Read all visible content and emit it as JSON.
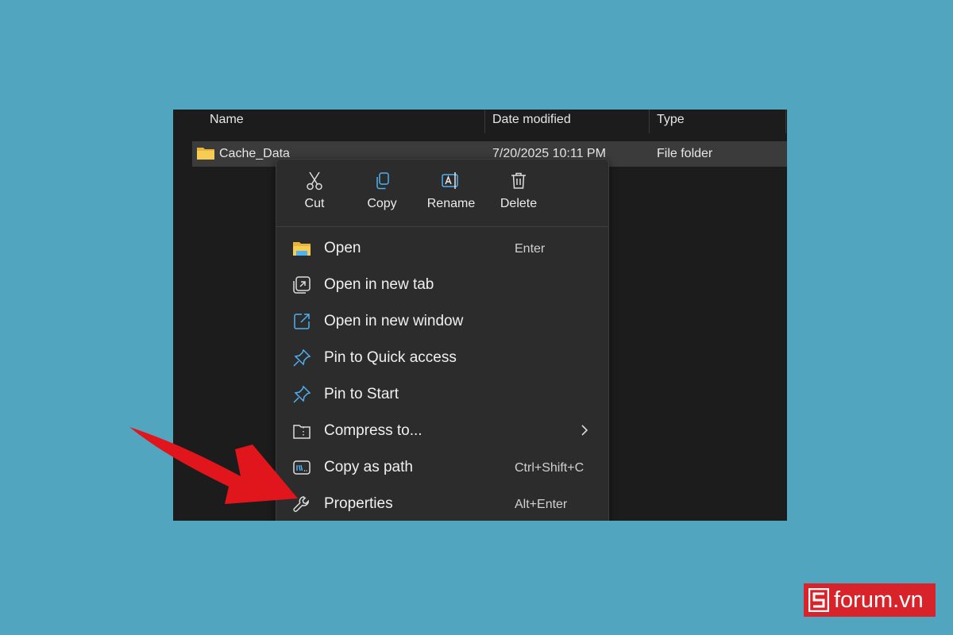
{
  "colors": {
    "background": "#52a5bf",
    "explorer_bg": "#1c1c1c",
    "menu_bg": "#2c2c2c",
    "arrow": "#e0161c",
    "brand": "#d8232a",
    "accent_blue": "#4fb0f2",
    "folder_yellow": "#f2c94c"
  },
  "explorer": {
    "columns": {
      "name": "Name",
      "date_modified": "Date modified",
      "type": "Type"
    },
    "selected_row": {
      "name": "Cache_Data",
      "date": "7/20/2025 10:11 PM",
      "type": "File folder"
    }
  },
  "context_menu": {
    "quick_actions": [
      {
        "label": "Cut",
        "icon": "scissors-icon"
      },
      {
        "label": "Copy",
        "icon": "copy-icon"
      },
      {
        "label": "Rename",
        "icon": "rename-icon"
      },
      {
        "label": "Delete",
        "icon": "trash-icon"
      }
    ],
    "items": [
      {
        "label": "Open",
        "shortcut": "Enter",
        "icon": "folder-icon"
      },
      {
        "label": "Open in new tab",
        "shortcut": "",
        "icon": "new-tab-icon"
      },
      {
        "label": "Open in new window",
        "shortcut": "",
        "icon": "new-window-icon"
      },
      {
        "label": "Pin to Quick access",
        "shortcut": "",
        "icon": "pin-icon"
      },
      {
        "label": "Pin to Start",
        "shortcut": "",
        "icon": "pin-icon"
      },
      {
        "label": "Compress to...",
        "shortcut": "",
        "icon": "zip-folder-icon",
        "submenu": true
      },
      {
        "label": "Copy as path",
        "shortcut": "Ctrl+Shift+C",
        "icon": "path-icon"
      },
      {
        "label": "Properties",
        "shortcut": "Alt+Enter",
        "icon": "wrench-icon"
      }
    ]
  },
  "watermark": {
    "brand": "forum.vn",
    "logo": "s-logo-icon"
  }
}
